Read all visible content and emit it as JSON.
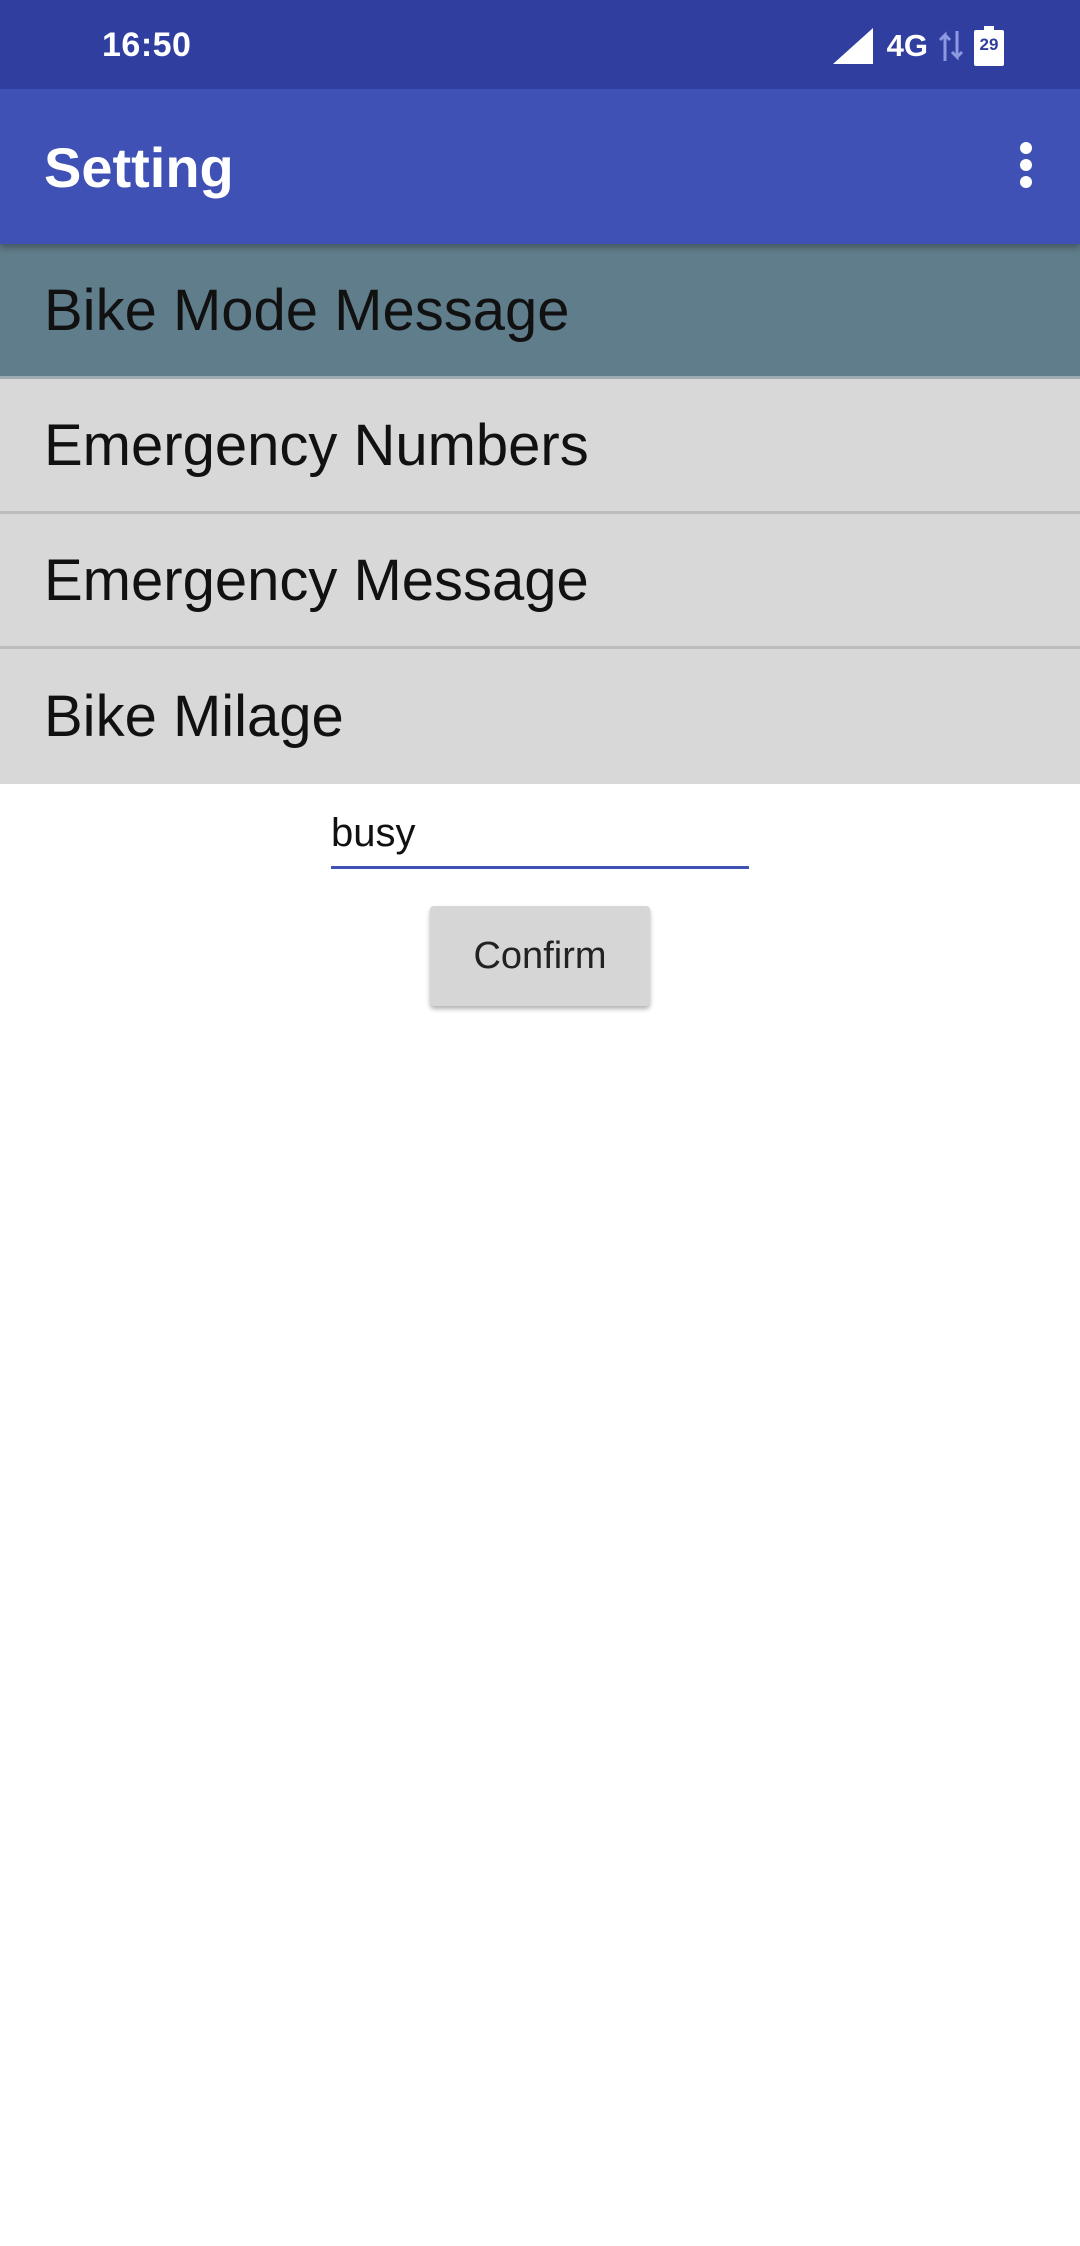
{
  "status_bar": {
    "time": "16:50",
    "network": "4G",
    "battery_level": "29",
    "icons": [
      "signal-icon",
      "data-transfer-icon",
      "battery-icon"
    ]
  },
  "app_bar": {
    "title": "Setting",
    "overflow_icon": "more-vert-icon"
  },
  "menu": {
    "items": [
      {
        "label": "Bike Mode Message",
        "selected": true
      },
      {
        "label": "Emergency Numbers",
        "selected": false
      },
      {
        "label": "Emergency Message",
        "selected": false
      },
      {
        "label": "Bike Milage",
        "selected": false
      }
    ]
  },
  "form": {
    "input_value": "busy",
    "confirm_label": "Confirm"
  },
  "colors": {
    "status_bar": "#303f9f",
    "app_bar": "#3f51b5",
    "selected_item": "#607d8b",
    "item_background": "#d8d8d8"
  }
}
